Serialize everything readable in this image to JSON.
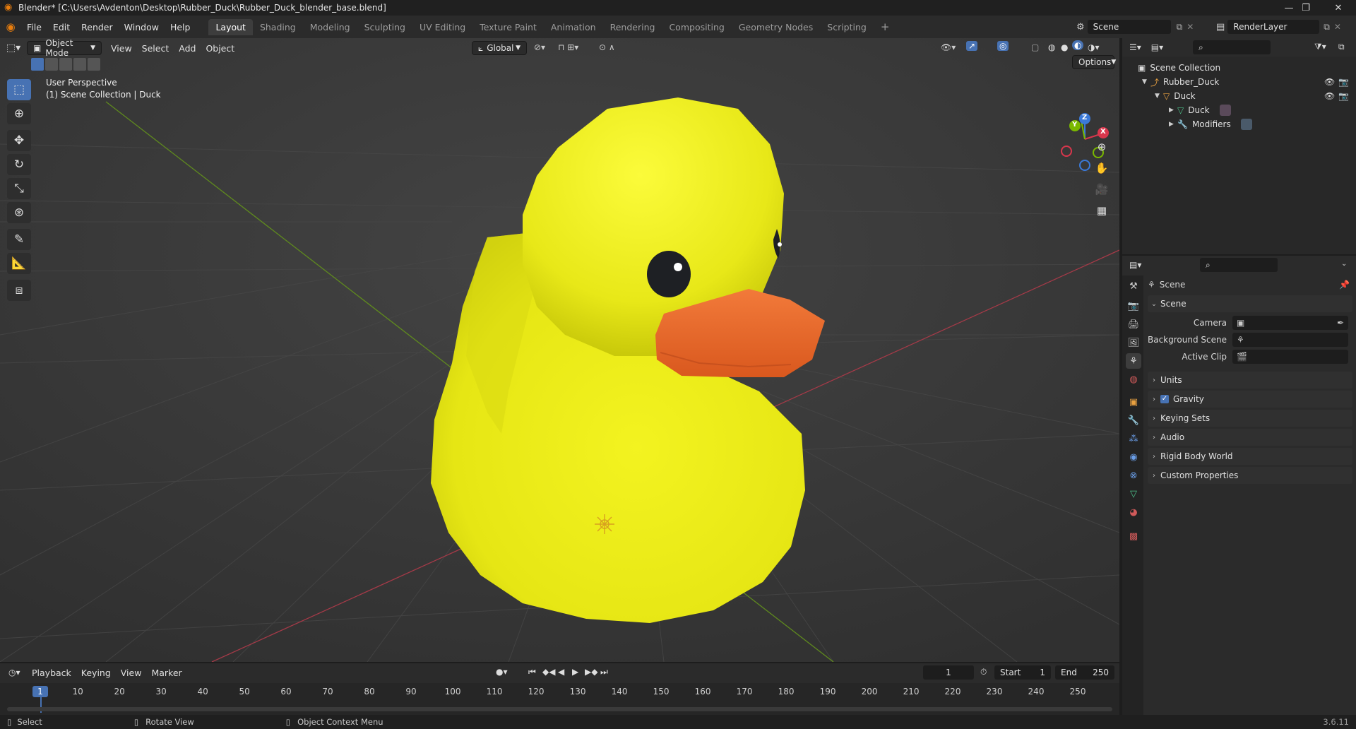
{
  "titlebar": {
    "title": "Blender* [C:\\Users\\Avdenton\\Desktop\\Rubber_Duck\\Rubber_Duck_blender_base.blend]",
    "minimize": "—",
    "restore": "❐",
    "close": "✕"
  },
  "menu": {
    "items": [
      "File",
      "Edit",
      "Render",
      "Window",
      "Help"
    ],
    "workspaces": [
      "Layout",
      "Shading",
      "Modeling",
      "Sculpting",
      "UV Editing",
      "Texture Paint",
      "Animation",
      "Rendering",
      "Compositing",
      "Geometry Nodes",
      "Scripting"
    ],
    "add_workspace": "+",
    "scene_name": "Scene",
    "render_layer": "RenderLayer"
  },
  "viewport": {
    "mode": "Object Mode",
    "menus": [
      "View",
      "Select",
      "Add",
      "Object"
    ],
    "orientation": "Global",
    "options_label": "Options",
    "overlay_title": "User Perspective",
    "overlay_subtitle": "(1) Scene Collection | Duck",
    "gizmo": {
      "x": "X",
      "y": "Y",
      "z": "Z"
    }
  },
  "outliner": {
    "rows": [
      {
        "label": "Scene Collection",
        "indent": 0
      },
      {
        "label": "Rubber_Duck",
        "indent": 1
      },
      {
        "label": "Duck",
        "indent": 2
      },
      {
        "label": "Duck",
        "indent": 3
      },
      {
        "label": "Modifiers",
        "indent": 3
      }
    ]
  },
  "properties": {
    "context": "Scene",
    "scene_panel": "Scene",
    "fields": [
      {
        "label": "Camera",
        "value": ""
      },
      {
        "label": "Background Scene",
        "value": ""
      },
      {
        "label": "Active Clip",
        "value": ""
      }
    ],
    "panels": [
      "Units",
      "Gravity",
      "Keying Sets",
      "Audio",
      "Rigid Body World",
      "Custom Properties"
    ]
  },
  "timeline": {
    "menus": [
      "Playback",
      "Keying",
      "View",
      "Marker"
    ],
    "current_frame": "1",
    "start_label": "Start",
    "start": "1",
    "end_label": "End",
    "end": "250",
    "ticks": [
      "1",
      "10",
      "20",
      "30",
      "40",
      "50",
      "60",
      "70",
      "80",
      "90",
      "100",
      "110",
      "120",
      "130",
      "140",
      "150",
      "160",
      "170",
      "180",
      "190",
      "200",
      "210",
      "220",
      "230",
      "240",
      "250"
    ]
  },
  "statusbar": {
    "select": "Select",
    "rotate": "Rotate View",
    "context_menu": "Object Context Menu",
    "version": "3.6.11"
  },
  "colors": {
    "accent": "#4772b3",
    "duck_body": "#f0f020",
    "duck_beak": "#e8662a",
    "x_axis": "#d9364c",
    "y_axis": "#7ab800",
    "z_axis": "#3b7ad9"
  }
}
